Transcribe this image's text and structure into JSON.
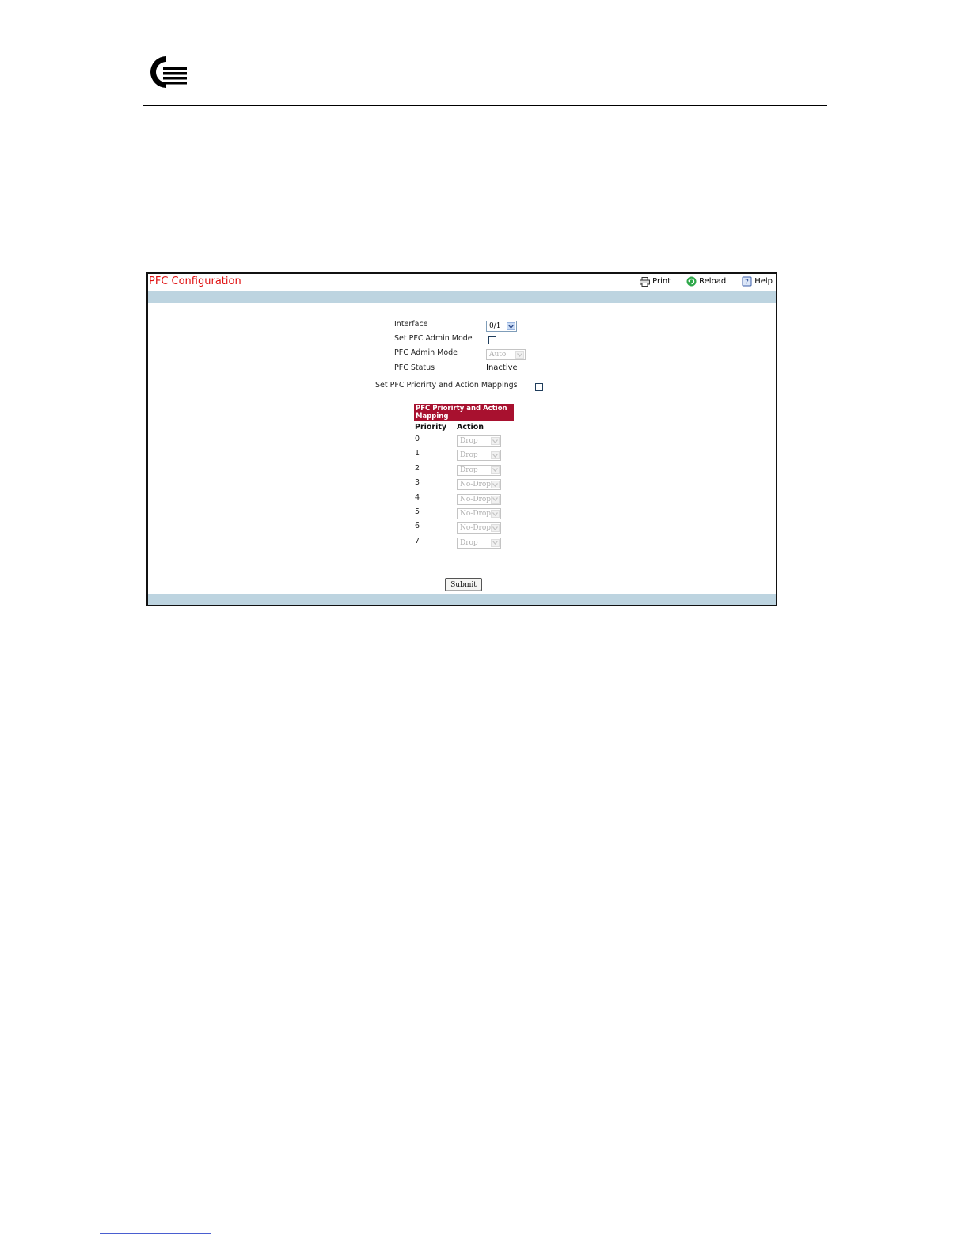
{
  "brand": {
    "logo_icon": "qlogic-logo-icon"
  },
  "header": {
    "title": "PFC Configuration",
    "title_color": "#e01010"
  },
  "toolbar": {
    "print_label": "Print",
    "reload_label": "Reload",
    "help_label": "Help"
  },
  "form": {
    "interface_label": "Interface",
    "interface_value": "0/1",
    "set_admin_mode_label": "Set PFC Admin Mode",
    "admin_mode_label": "PFC Admin Mode",
    "admin_mode_value": "Auto",
    "status_label": "PFC Status",
    "status_value": "Inactive",
    "set_mappings_label": "Set PFC Priorirty and Action Mappings"
  },
  "mapping": {
    "header": "PFC Priorirty and Action Mapping",
    "col_priority": "Priority",
    "col_action": "Action",
    "rows": [
      {
        "priority": "0",
        "action": "Drop"
      },
      {
        "priority": "1",
        "action": "Drop"
      },
      {
        "priority": "2",
        "action": "Drop"
      },
      {
        "priority": "3",
        "action": "No-Drop"
      },
      {
        "priority": "4",
        "action": "No-Drop"
      },
      {
        "priority": "5",
        "action": "No-Drop"
      },
      {
        "priority": "6",
        "action": "No-Drop"
      },
      {
        "priority": "7",
        "action": "Drop"
      }
    ]
  },
  "submit_label": "Submit",
  "colors": {
    "band": "#bdd4e0",
    "mapping_header": "#a8112f"
  }
}
